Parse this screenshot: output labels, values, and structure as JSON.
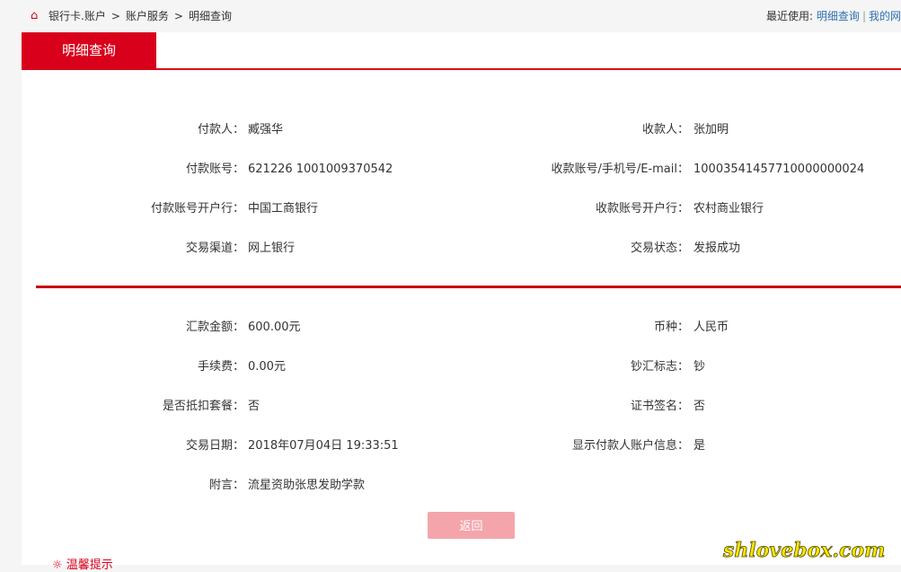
{
  "breadcrumb": {
    "items": [
      "银行卡.账户",
      ">",
      "账户服务",
      ">",
      "明细查询"
    ]
  },
  "recent": {
    "label": "最近使用:",
    "link1": "明细查询",
    "sep": "|",
    "link2": "我的网"
  },
  "tab": {
    "label": "明细查询"
  },
  "section1": {
    "left": [
      {
        "label": "付款人：",
        "value": "臧强华"
      },
      {
        "label": "付款账号：",
        "value": "621226 1001009370542"
      },
      {
        "label": "付款账号开户行：",
        "value": "中国工商银行"
      },
      {
        "label": "交易渠道：",
        "value": "网上银行"
      }
    ],
    "right": [
      {
        "label": "收款人：",
        "value": "张加明"
      },
      {
        "label": "收款账号/手机号/E-mail：",
        "value": "10003541457710000000024"
      },
      {
        "label": "收款账号开户行：",
        "value": "农村商业银行"
      },
      {
        "label": "交易状态：",
        "value": "发报成功"
      }
    ]
  },
  "section2": {
    "left": [
      {
        "label": "汇款金额：",
        "value": "600.00元"
      },
      {
        "label": "手续费：",
        "value": "0.00元"
      },
      {
        "label": "是否抵扣套餐：",
        "value": "否"
      },
      {
        "label": "交易日期：",
        "value": "2018年07月04日 19:33:51"
      },
      {
        "label": "附言：",
        "value": "流星资助张思发助学款"
      }
    ],
    "right": [
      {
        "label": "币种：",
        "value": "人民币"
      },
      {
        "label": "钞汇标志：",
        "value": "钞"
      },
      {
        "label": "证书签名：",
        "value": "否"
      },
      {
        "label": "显示付款人账户信息：",
        "value": "是"
      }
    ]
  },
  "actions": {
    "back_label": "返回"
  },
  "footer_tip": "温馨提示",
  "watermark": {
    "text": "shlovebox.com"
  },
  "colors": {
    "accent": "#d9001b",
    "button": "#f4a5ab",
    "link": "#2f6fb3"
  }
}
